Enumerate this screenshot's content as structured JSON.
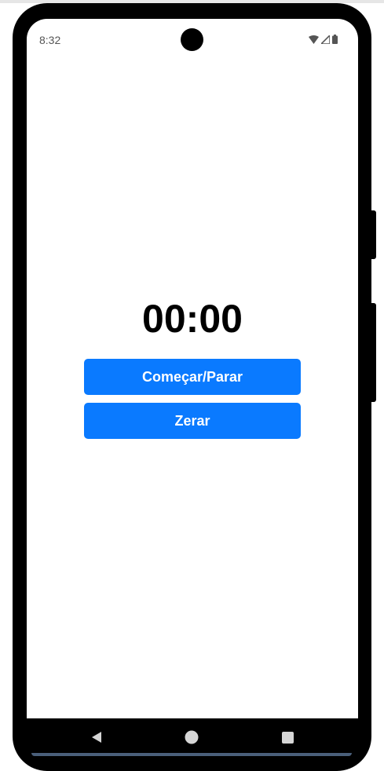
{
  "status_bar": {
    "time": "8:32",
    "icons": [
      "wifi-icon",
      "signal-icon",
      "battery-icon"
    ]
  },
  "timer": {
    "display": "00:00"
  },
  "buttons": {
    "start_stop_label": "Começar/Parar",
    "reset_label": "Zerar"
  },
  "navigation": {
    "icons": [
      "back-icon",
      "home-icon",
      "recents-icon"
    ]
  },
  "colors": {
    "accent": "#0a7aff",
    "frame": "#000000",
    "background": "#ffffff"
  }
}
